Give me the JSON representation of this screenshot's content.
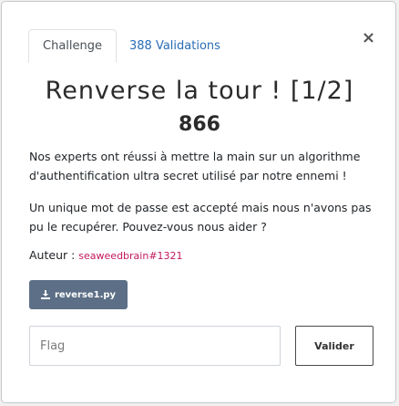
{
  "tabs": [
    {
      "label": "Challenge",
      "active": true
    },
    {
      "label": "388 Validations",
      "active": false
    }
  ],
  "close_icon": "×",
  "challenge": {
    "title": "Renverse la tour ! [1/2]",
    "points": "866",
    "description": [
      "Nos experts ont réussi à mettre la main sur un algorithme d'authentification ultra secret utilisé par notre ennemi !",
      "Un unique mot de passe est accepté mais nous n'avons pas pu le recupérer. Pouvez-vous nous aider ?"
    ],
    "author_label": "Auteur :",
    "author_name": "seaweedbrain#1321",
    "file_name": "reverse1.py"
  },
  "form": {
    "flag_placeholder": "Flag",
    "flag_value": "",
    "submit_label": "Valider"
  },
  "colors": {
    "link": "#2a6db5",
    "author": "#c2185b",
    "file_button": "#5c6f86"
  },
  "icons": {
    "download": "download-icon",
    "close": "close-icon"
  }
}
